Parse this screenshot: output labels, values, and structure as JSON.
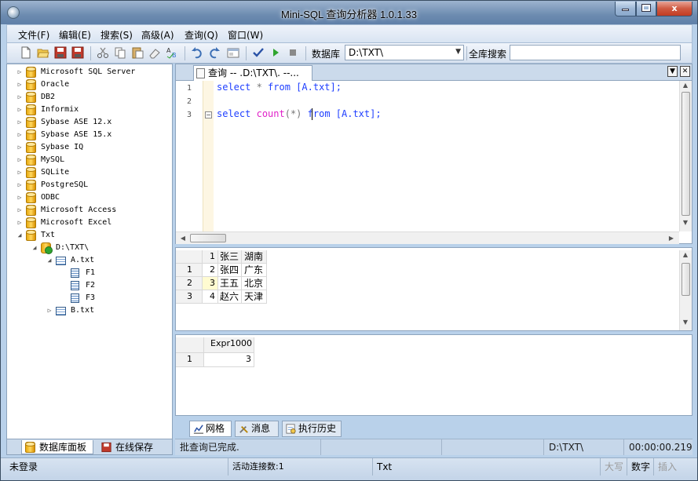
{
  "window": {
    "title": "Mini-SQL 查询分析器 1.0.1.33",
    "controls": {
      "min": "",
      "max": "",
      "close": "x"
    }
  },
  "menu": [
    "文件(F)",
    "编辑(E)",
    "搜索(S)",
    "高级(A)",
    "查询(Q)",
    "窗口(W)"
  ],
  "toolbar": {
    "icons": [
      "new-file-icon",
      "open-folder-icon",
      "save-icon",
      "save-all-icon",
      "cut-icon",
      "copy-icon",
      "paste-icon",
      "clear-icon",
      "spell-check-icon",
      "undo-icon",
      "redo-icon",
      "panel-icon",
      "check-icon",
      "run-icon",
      "stop-icon"
    ],
    "database_label": "数据库",
    "database_value": "D:\\TXT\\",
    "global_search_label": "全库搜索",
    "global_search_value": ""
  },
  "tree": {
    "nodes": [
      {
        "label": "Microsoft SQL Server",
        "type": "database"
      },
      {
        "label": "Oracle",
        "type": "database"
      },
      {
        "label": "DB2",
        "type": "database"
      },
      {
        "label": "Informix",
        "type": "database"
      },
      {
        "label": "Sybase ASE 12.x",
        "type": "database"
      },
      {
        "label": "Sybase ASE 15.x",
        "type": "database"
      },
      {
        "label": "Sybase IQ",
        "type": "database"
      },
      {
        "label": "MySQL",
        "type": "database"
      },
      {
        "label": "SQLite",
        "type": "database"
      },
      {
        "label": "PostgreSQL",
        "type": "database"
      },
      {
        "label": "ODBC",
        "type": "database"
      },
      {
        "label": "Microsoft Access",
        "type": "database"
      },
      {
        "label": "Microsoft Excel",
        "type": "database"
      },
      {
        "label": "Txt",
        "type": "database",
        "expanded": true
      },
      {
        "label": "D:\\TXT\\",
        "type": "connection",
        "expanded": true
      },
      {
        "label": "A.txt",
        "type": "table",
        "expanded": true
      },
      {
        "label": "F1",
        "type": "field"
      },
      {
        "label": "F2",
        "type": "field"
      },
      {
        "label": "F3",
        "type": "field"
      },
      {
        "label": "B.txt",
        "type": "table"
      }
    ]
  },
  "left_tabs": [
    "数据库面板",
    "在线保存"
  ],
  "editor": {
    "tab_title": "查询 -- .D:\\TXT\\. --...",
    "line_numbers": [
      "1",
      "2",
      "3"
    ],
    "line1": {
      "kw1": "select",
      "star": " * ",
      "kw2": "from",
      "obj": " [A.txt];"
    },
    "line3": {
      "kw1": "select",
      "fn": "count",
      "args": "(*)",
      "kw2": "from",
      "obj": " [A.txt];"
    }
  },
  "grid1": {
    "header": [
      "1",
      "张三",
      "湖南"
    ],
    "rows": [
      {
        "rownum": "1",
        "c0": "2",
        "c1": "张四",
        "c2": "广东"
      },
      {
        "rownum": "2",
        "c0": "3",
        "c1": "王五",
        "c2": "北京"
      },
      {
        "rownum": "3",
        "c0": "4",
        "c1": "赵六",
        "c2": "天津"
      }
    ]
  },
  "grid2": {
    "header": [
      "Expr1000"
    ],
    "rows": [
      {
        "rownum": "1",
        "c0": "3"
      }
    ]
  },
  "bottom_tabs": [
    "网格",
    "消息",
    "执行历史"
  ],
  "status": {
    "message": "批查询已完成.",
    "database": "D:\\TXT\\",
    "elapsed": "00:00:00.219",
    "login": "未登录",
    "connections": "活动连接数:1",
    "db_type": "Txt",
    "caps": "大写",
    "num": "数字",
    "insert": "插入"
  }
}
